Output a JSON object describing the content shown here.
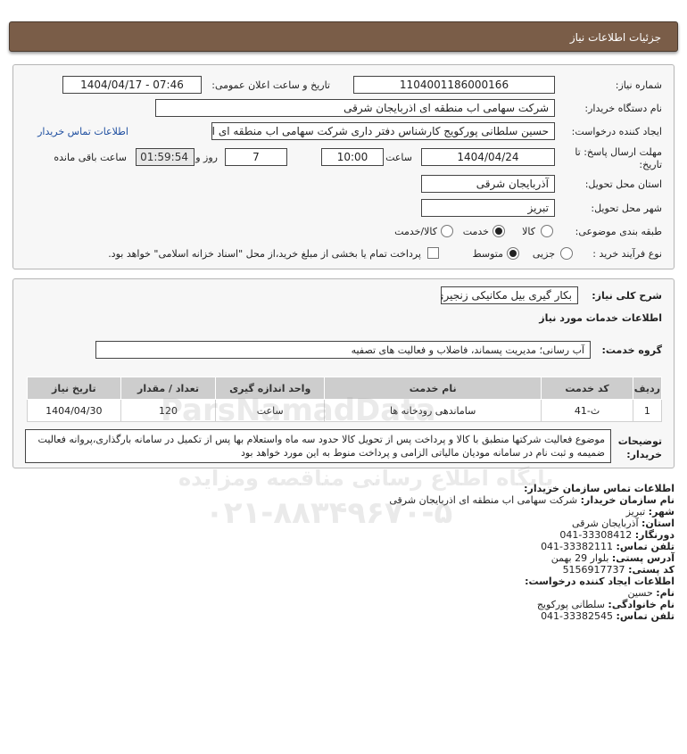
{
  "header": {
    "title": "جزئیات اطلاعات نیاز"
  },
  "main": {
    "need_number_label": "شماره نیاز:",
    "need_number": "1104001186000166",
    "announce_label": "تاریخ و ساعت اعلان عمومی:",
    "announce_value": "1404/04/17 - 07:46",
    "buyer_label": "نام دستگاه خریدار:",
    "buyer_value": "شرکت سهامی اب منطقه ای اذربایجان شرقی",
    "creator_label": "ایجاد کننده درخواست:",
    "creator_value": "حسین سلطانی پورکویج کارشناس دفتر داری شرکت سهامی اب منطقه ای اذربایجان شرقی",
    "contact_link": "اطلاعات تماس خریدار",
    "deadline_label": "مهلت ارسال پاسخ: تا تاریخ:",
    "deadline_date": "1404/04/24",
    "time_label": "ساعت",
    "deadline_time": "10:00",
    "days_value": "7",
    "days_label": "روز و",
    "remaining_time": "01:59:54",
    "remaining_label": "ساعت باقی مانده",
    "province_label": "استان محل تحویل:",
    "province_value": "آذربایجان شرقی",
    "city_label": "شهر محل تحویل:",
    "city_value": "تبریز",
    "category_label": "طبقه بندی موضوعی:",
    "category_options": [
      "کالا",
      "خدمت",
      "کالا/خدمت"
    ],
    "category_selected": "خدمت",
    "process_label": "نوع فرآیند خرید :",
    "process_options": [
      "جزیی",
      "متوسط"
    ],
    "process_selected": "متوسط",
    "payment_note": "پرداخت تمام یا بخشی از مبلغ خرید،از محل \"اسناد خزانه اسلامی\" خواهد بود."
  },
  "description": {
    "need_summary_label": "شرح کلی نیاز:",
    "need_summary": "بکار گیری بیل مکانیکی زنجیری",
    "services_heading": "اطلاعات خدمات مورد نیاز",
    "service_group_label": "گروه خدمت:",
    "service_group": "آب رسانی؛ مدیریت پسماند، فاضلاب و فعالیت های تصفیه",
    "table_headers": [
      "ردیف",
      "کد خدمت",
      "نام خدمت",
      "واحد اندازه گیری",
      "تعداد / مقدار",
      "تاریخ نیاز"
    ],
    "table_rows": [
      [
        "1",
        "ث-41",
        "ساماندهی رودخانه ها",
        "ساعت",
        "120",
        "1404/04/30"
      ]
    ],
    "buyer_notes_label": "توضیحات خریدار:",
    "buyer_notes": "موضوع فعالیت شرکتها منطبق با کالا و پرداخت پس از تحویل کالا حدود سه ماه واستعلام بها پس از تکمیل در سامانه بارگذاری،پروانه فعالیت ضمیمه و ثبت نام در سامانه مودیان مالیاتی الزامی و پرداخت منوط به این مورد خواهد بود"
  },
  "contact": {
    "org_heading": "اطلاعات تماس سازمان خریدار:",
    "org_name_label": "نام سازمان خریدار:",
    "org_name": "شرکت سهامی اب منطقه ای اذربایجان شرقی",
    "city_label": "شهر:",
    "city": "تبریز",
    "province_label": "استان:",
    "province": "آذربایجان شرقی",
    "fax_label": "دورنگار:",
    "fax": "041-33308412",
    "phone_label": "تلفن تماس:",
    "phone": "041-33382111",
    "address_label": "آدرس پستی:",
    "address": "بلوار 29 بهمن",
    "postal_label": "کد پستی:",
    "postal": "5156917737",
    "creator_heading": "اطلاعات ایجاد کننده درخواست:",
    "first_name_label": "نام:",
    "first_name": "حسین",
    "last_name_label": "نام خانوادگی:",
    "last_name": "سلطانی پورکویج",
    "creator_phone_label": "تلفن تماس:",
    "creator_phone": "041-33382545"
  },
  "watermark": {
    "brand": "ParsNamadData",
    "line1": "پایگاه اطلاع رسانی مناقصه ومزایده",
    "phone": "۰۲۱-۸۸۳۴۹۶۷۰-۵"
  }
}
